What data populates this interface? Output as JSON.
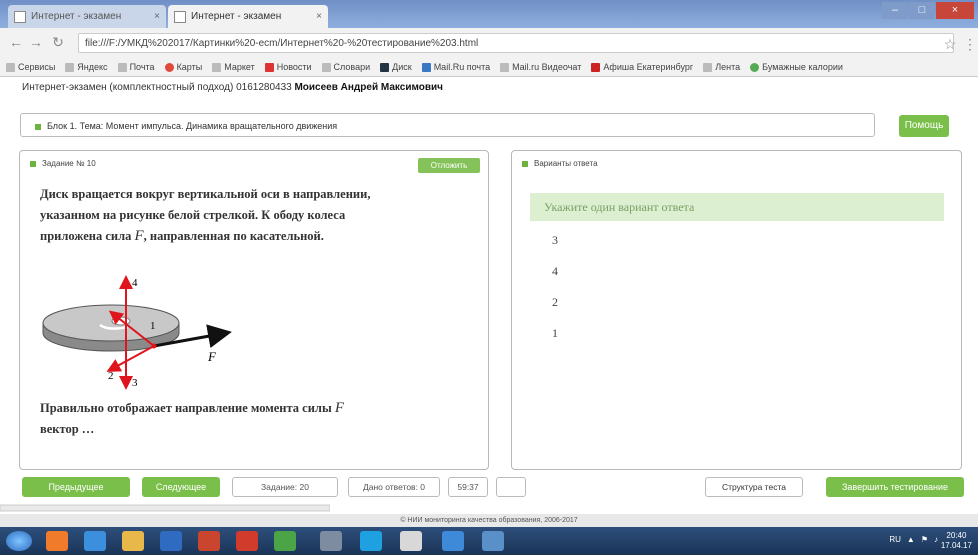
{
  "browser": {
    "tabs": [
      {
        "label": "Интернет - экзамен",
        "active": false
      },
      {
        "label": "Интернет - экзамен",
        "active": true
      }
    ],
    "url": "file:///F:/УМКД%202017/Картинки%20-ecm/Интернет%20-%20тестирование%203.html",
    "bookmarks": [
      "Сервисы",
      "Яндекс",
      "Почта",
      "Карты",
      "Маркет",
      "Новости",
      "Словари",
      "Диск",
      "Mail.Ru почта",
      "Mail.ru Видеочат",
      "Афиша Екатеринбург",
      "Лента",
      "Бумажные калории"
    ]
  },
  "exam": {
    "header_prefix": "Интернет-экзамен (комплектностный подход) 0161280433",
    "student_name": "Моисеев Андрей Максимович",
    "block_label": "Блок 1. Тема: Момент импульса. Динамика вращательного движения",
    "help_label": "Помощь"
  },
  "question": {
    "title": "Задание № 10",
    "skip_label": "Отложить",
    "text_part1": "Диск вращается вокруг вертикальной оси в направлении, указанном на рисунке белой стрелкой. К ободу колеса приложена сила",
    "force_symbol": "F",
    "text_part2": ", направленная по касательной.",
    "bottom_text_part1": "Правильно отображает направление момента силы",
    "bottom_text_part2": "вектор …",
    "diagram_labels": {
      "l1": "1",
      "l2": "2",
      "l3": "3",
      "l4": "4",
      "force": "F"
    }
  },
  "answers": {
    "title": "Варианты ответа",
    "drop_hint": "Укажите один вариант ответа",
    "options": [
      "3",
      "4",
      "2",
      "1"
    ]
  },
  "nav": {
    "prev_label": "Предыдущее",
    "next_label": "Следующее",
    "task_counter": "Задание: 20",
    "answered": "Дано ответов: 0",
    "timer": "59:37",
    "structure_label": "Структура теста",
    "finish_label": "Завершить тестирование"
  },
  "footer": "© НИИ мониторинга качества образования, 2006-2017",
  "taskbar": {
    "clock_time": "20:40",
    "clock_date": "17.04.17",
    "lang": "RU"
  },
  "colors": {
    "accent_green": "#7bbf4b",
    "drop_bg": "#dcefd0",
    "force_red": "#e0141c"
  }
}
